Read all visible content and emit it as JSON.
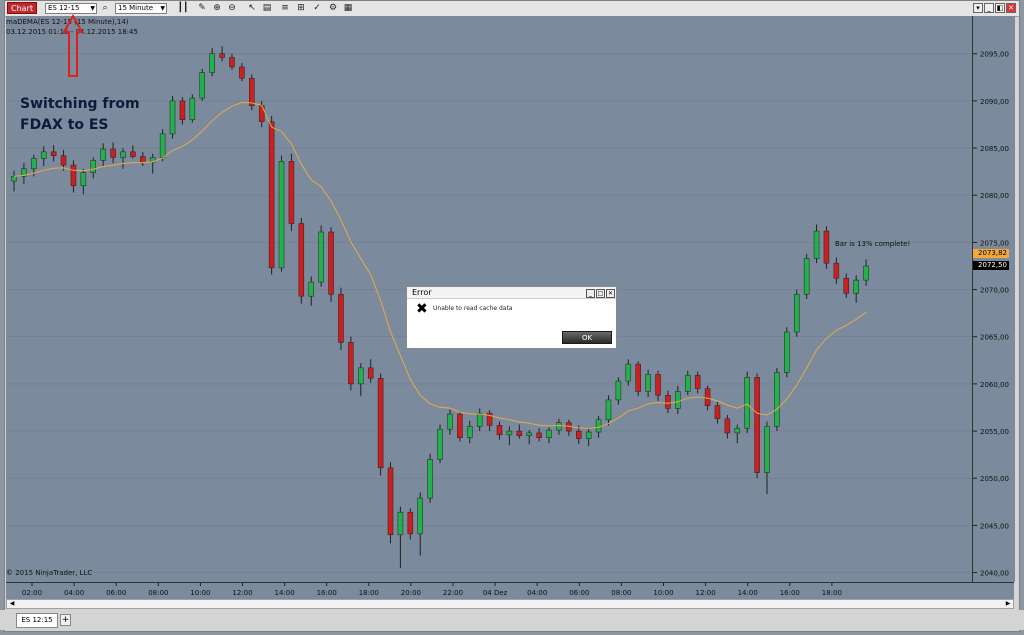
{
  "toolbar": {
    "chart_label": "Chart",
    "instrument": "ES 12-15",
    "interval": "15 Minute",
    "icons": [
      "search-icon",
      "bar-type-icon",
      "pencil-icon",
      "zoom-in-icon",
      "zoom-out-icon",
      "cursor-icon",
      "properties-icon",
      "data-box-icon",
      "crosshair-icon",
      "indicator-icon",
      "strategy-icon"
    ]
  },
  "window_controls": {
    "minimize": "_",
    "maximize": "□",
    "restore": "◧",
    "close": "✕"
  },
  "indicator_label_line1": "maDEMA(ES 12-15 (15 Minute),14)",
  "indicator_label_line2": "03.12.2015 01:15 - 04.12.2015 18:45",
  "annotation": "Switching from FDAX to ES",
  "copyright": "© 2015 NinjaTrader, LLC",
  "bar_status": "Bar is 13% complete!",
  "price_tags": [
    {
      "value": "2073,82",
      "color": "#f2a93b"
    },
    {
      "value": "2072,50",
      "color": "#000000"
    }
  ],
  "dialog": {
    "title": "Error",
    "message": "Unable to read cache data",
    "ok_label": "OK"
  },
  "tabs": [
    {
      "label": "ES 12:15"
    }
  ],
  "chart_data": {
    "type": "candlestick",
    "y_ticks": [
      "2095,00",
      "2090,00",
      "2085,00",
      "2080,00",
      "2075,00",
      "2070,00",
      "2065,00",
      "2060,00",
      "2055,00",
      "2050,00",
      "2045,00",
      "2040,00"
    ],
    "ylim": [
      2039,
      2099
    ],
    "x_ticks": [
      "02:00",
      "04:00",
      "06:00",
      "08:00",
      "10:00",
      "12:00",
      "14:00",
      "16:00",
      "18:00",
      "20:00",
      "22:00",
      "04 Dez",
      "04:00",
      "06:00",
      "08:00",
      "10:00",
      "12:00",
      "14:00",
      "16:00",
      "18:00"
    ],
    "up_color": "#22b14c",
    "down_color": "#cc1f1f",
    "ma_color": "#e7a94c",
    "series": [
      {
        "name": "ES 12-15",
        "ohlc": [
          [
            2081.5,
            2082.6,
            2080.4,
            2082.0
          ],
          [
            2082.0,
            2083.4,
            2081.2,
            2082.8
          ],
          [
            2082.8,
            2084.3,
            2082.0,
            2083.9
          ],
          [
            2083.9,
            2085.2,
            2083.1,
            2084.6
          ],
          [
            2084.6,
            2085.3,
            2083.6,
            2084.2
          ],
          [
            2084.2,
            2084.8,
            2082.6,
            2083.2
          ],
          [
            2083.2,
            2083.7,
            2080.3,
            2081.0
          ],
          [
            2081.0,
            2082.8,
            2080.1,
            2082.4
          ],
          [
            2082.4,
            2084.0,
            2081.8,
            2083.7
          ],
          [
            2083.7,
            2085.5,
            2083.0,
            2084.9
          ],
          [
            2084.9,
            2085.6,
            2083.4,
            2084.0
          ],
          [
            2084.0,
            2085.0,
            2082.8,
            2084.6
          ],
          [
            2084.6,
            2085.3,
            2083.9,
            2084.1
          ],
          [
            2084.1,
            2084.6,
            2083.1,
            2083.5
          ],
          [
            2083.5,
            2084.4,
            2082.3,
            2084.0
          ],
          [
            2084.0,
            2087.0,
            2083.6,
            2086.5
          ],
          [
            2086.5,
            2090.5,
            2086.0,
            2090.0
          ],
          [
            2090.0,
            2090.4,
            2087.5,
            2088.0
          ],
          [
            2088.0,
            2090.7,
            2087.7,
            2090.3
          ],
          [
            2090.3,
            2093.4,
            2090.0,
            2093.0
          ],
          [
            2093.0,
            2095.6,
            2092.6,
            2095.0
          ],
          [
            2095.0,
            2095.8,
            2094.2,
            2094.6
          ],
          [
            2094.6,
            2095.0,
            2093.3,
            2093.6
          ],
          [
            2093.6,
            2094.0,
            2092.1,
            2092.4
          ],
          [
            2092.4,
            2092.8,
            2089.0,
            2089.5
          ],
          [
            2089.5,
            2090.0,
            2087.2,
            2087.8
          ],
          [
            2087.8,
            2088.4,
            2071.6,
            2072.3
          ],
          [
            2072.3,
            2084.2,
            2071.9,
            2083.6
          ],
          [
            2083.6,
            2084.4,
            2076.2,
            2077.0
          ],
          [
            2077.0,
            2077.6,
            2068.5,
            2069.3
          ],
          [
            2069.3,
            2071.4,
            2068.3,
            2070.8
          ],
          [
            2070.8,
            2076.8,
            2070.3,
            2076.1
          ],
          [
            2076.1,
            2076.6,
            2068.7,
            2069.5
          ],
          [
            2069.5,
            2070.2,
            2063.6,
            2064.4
          ],
          [
            2064.4,
            2065.0,
            2059.3,
            2060.0
          ],
          [
            2060.0,
            2062.2,
            2058.7,
            2061.7
          ],
          [
            2061.7,
            2062.6,
            2060.1,
            2060.6
          ],
          [
            2060.6,
            2061.1,
            2050.3,
            2051.1
          ],
          [
            2051.1,
            2051.7,
            2043.1,
            2044.0
          ],
          [
            2044.0,
            2047.0,
            2040.5,
            2046.4
          ],
          [
            2046.4,
            2046.8,
            2043.5,
            2044.1
          ],
          [
            2044.1,
            2048.5,
            2041.8,
            2047.9
          ],
          [
            2047.9,
            2052.6,
            2047.4,
            2052.0
          ],
          [
            2052.0,
            2055.7,
            2051.6,
            2055.2
          ],
          [
            2055.2,
            2057.3,
            2054.6,
            2056.8
          ],
          [
            2056.8,
            2057.1,
            2053.9,
            2054.3
          ],
          [
            2054.3,
            2056.1,
            2053.7,
            2055.5
          ],
          [
            2055.5,
            2057.4,
            2055.0,
            2056.9
          ],
          [
            2056.9,
            2057.2,
            2055.0,
            2055.6
          ],
          [
            2055.6,
            2056.0,
            2054.1,
            2054.6
          ],
          [
            2054.6,
            2055.5,
            2053.5,
            2055.0
          ],
          [
            2055.0,
            2055.7,
            2054.2,
            2054.5
          ],
          [
            2054.5,
            2055.1,
            2053.6,
            2054.8
          ],
          [
            2054.8,
            2055.3,
            2053.9,
            2054.3
          ],
          [
            2054.3,
            2055.4,
            2053.7,
            2055.1
          ],
          [
            2055.1,
            2056.3,
            2054.6,
            2055.9
          ],
          [
            2055.9,
            2056.2,
            2054.5,
            2055.0
          ],
          [
            2055.0,
            2055.6,
            2053.6,
            2054.2
          ],
          [
            2054.2,
            2055.3,
            2053.4,
            2054.9
          ],
          [
            2054.9,
            2056.6,
            2054.3,
            2056.2
          ],
          [
            2056.2,
            2058.8,
            2055.6,
            2058.3
          ],
          [
            2058.3,
            2060.7,
            2057.8,
            2060.3
          ],
          [
            2060.3,
            2062.6,
            2059.8,
            2062.1
          ],
          [
            2062.1,
            2062.4,
            2058.7,
            2059.2
          ],
          [
            2059.2,
            2061.5,
            2058.6,
            2061.0
          ],
          [
            2061.0,
            2061.4,
            2058.2,
            2058.8
          ],
          [
            2058.8,
            2059.3,
            2056.9,
            2057.4
          ],
          [
            2057.4,
            2059.8,
            2056.8,
            2059.2
          ],
          [
            2059.2,
            2061.4,
            2058.8,
            2060.9
          ],
          [
            2060.9,
            2061.3,
            2059.0,
            2059.5
          ],
          [
            2059.5,
            2059.8,
            2057.2,
            2057.7
          ],
          [
            2057.7,
            2058.1,
            2055.8,
            2056.3
          ],
          [
            2056.3,
            2056.7,
            2054.2,
            2054.8
          ],
          [
            2054.8,
            2055.7,
            2053.7,
            2055.3
          ],
          [
            2055.3,
            2061.3,
            2054.8,
            2060.7
          ],
          [
            2060.7,
            2061.1,
            2050.0,
            2050.6
          ],
          [
            2050.6,
            2056.0,
            2048.3,
            2055.5
          ],
          [
            2055.5,
            2061.7,
            2055.0,
            2061.2
          ],
          [
            2061.2,
            2066.0,
            2060.7,
            2065.5
          ],
          [
            2065.5,
            2070.0,
            2065.0,
            2069.5
          ],
          [
            2069.5,
            2073.8,
            2069.0,
            2073.3
          ],
          [
            2073.3,
            2076.9,
            2072.8,
            2076.2
          ],
          [
            2076.2,
            2076.7,
            2072.2,
            2072.8
          ],
          [
            2072.8,
            2073.4,
            2070.6,
            2071.2
          ],
          [
            2071.2,
            2071.7,
            2069.1,
            2069.6
          ],
          [
            2069.6,
            2071.5,
            2068.6,
            2071.0
          ],
          [
            2071.0,
            2073.2,
            2070.4,
            2072.5
          ]
        ]
      }
    ]
  }
}
